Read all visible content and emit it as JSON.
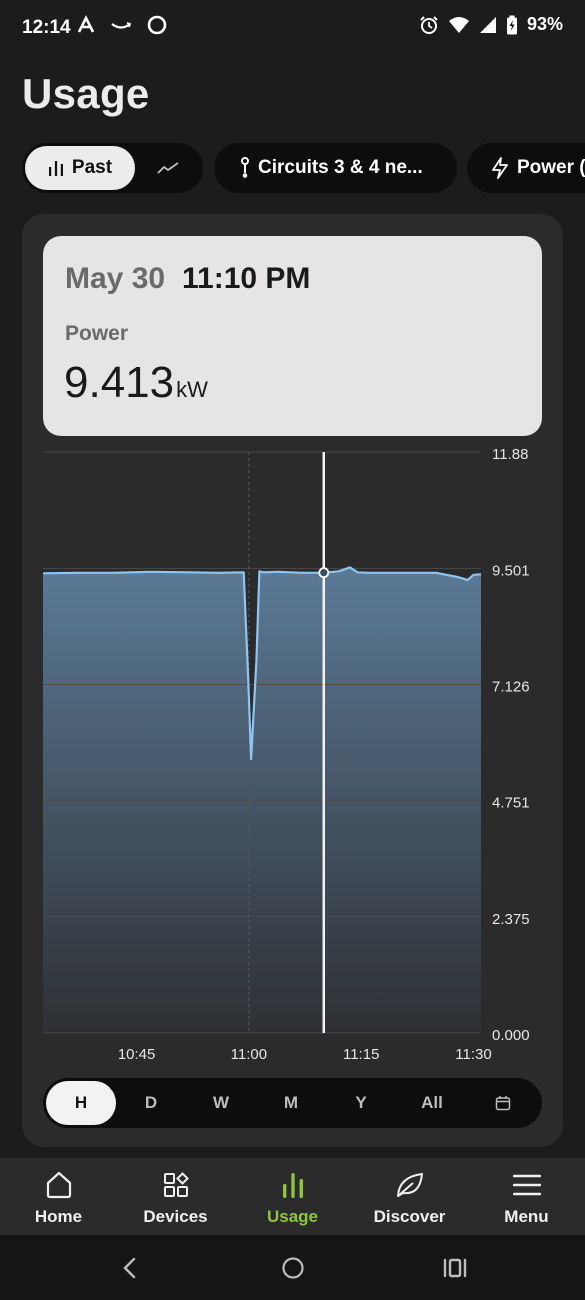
{
  "status_bar": {
    "time": "12:14",
    "battery": "93%",
    "icons": [
      "a-notification-icon",
      "amazon-smile-icon",
      "circle-app-icon",
      "alarm-icon",
      "wifi-icon",
      "cell-signal-icon",
      "battery-icon"
    ]
  },
  "page": {
    "title": "Usage"
  },
  "filters": {
    "mode_past_label": "Past",
    "mode_trend_icon": "trend-line-icon",
    "circuit_label": "Circuits 3 & 4 ne...",
    "metric_label": "Power ("
  },
  "tooltip": {
    "date": "May 30",
    "time": "11:10 PM",
    "metric": "Power",
    "value": "9.413",
    "unit": "kW"
  },
  "colors": {
    "accent": "#8cc63f",
    "line": "#8ec5f2",
    "area_top": "#5b7a96",
    "area_bottom": "#2f3034",
    "card": "#2b2b2b",
    "background": "#1c1c1c"
  },
  "chart_data": {
    "type": "area",
    "ylim": [
      0,
      11.88
    ],
    "y_ticks": [
      "11.88",
      "9.501",
      "7.126",
      "4.751",
      "2.375",
      "0.000"
    ],
    "y_tick_values": [
      11.88,
      9.501,
      7.126,
      4.751,
      2.375,
      0.0
    ],
    "x_ticks": [
      "10:45",
      "11:00",
      "11:15",
      "11:30"
    ],
    "x_tick_minutes": [
      45,
      60,
      75,
      90
    ],
    "xlim_minutes": [
      32.5,
      91
    ],
    "unit": "kW",
    "cursor_minute": 70,
    "cursor_value": 9.413,
    "series": [
      {
        "x": [
          32.5,
          37,
          42,
          47,
          52,
          56,
          59.3,
          59.9,
          60.3,
          61,
          61.4,
          61.9,
          64,
          67,
          70,
          72,
          73.5,
          74.5,
          76,
          80,
          85,
          88,
          89.2,
          90,
          91
        ],
        "values": [
          9.4,
          9.41,
          9.41,
          9.43,
          9.42,
          9.41,
          9.42,
          7.3,
          5.6,
          7.6,
          9.44,
          9.42,
          9.43,
          9.41,
          9.413,
          9.44,
          9.52,
          9.42,
          9.41,
          9.41,
          9.41,
          9.32,
          9.26,
          9.37,
          9.38
        ]
      }
    ]
  },
  "range_selector": {
    "options": [
      "H",
      "D",
      "W",
      "M",
      "Y",
      "All"
    ],
    "active": "H",
    "calendar_icon": "calendar-icon"
  },
  "bottom_nav": {
    "items": [
      {
        "label": "Home",
        "icon": "home-icon"
      },
      {
        "label": "Devices",
        "icon": "devices-icon"
      },
      {
        "label": "Usage",
        "icon": "usage-bars-icon"
      },
      {
        "label": "Discover",
        "icon": "leaf-icon"
      },
      {
        "label": "Menu",
        "icon": "menu-icon"
      }
    ],
    "active": "Usage"
  },
  "system_nav": {
    "icons": [
      "back-icon",
      "home-circle-icon",
      "recents-icon"
    ]
  }
}
